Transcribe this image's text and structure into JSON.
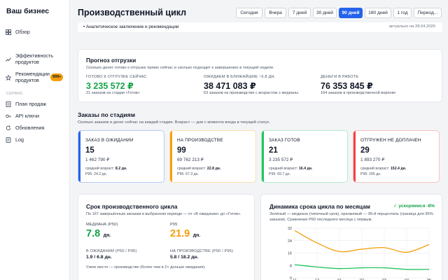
{
  "brand": "Ваш бизнес",
  "nav": [
    {
      "label": "Обзор",
      "icon": "grid-icon"
    },
    {
      "label": "Эффективность продуктов",
      "icon": "trend-icon"
    },
    {
      "label": "Рекомендации продуктов",
      "icon": "star-icon",
      "badge": "999+"
    }
  ],
  "nav_section": "СЕРВИС",
  "nav_service": [
    {
      "label": "План продаж",
      "icon": "document-icon"
    },
    {
      "label": "API ключи",
      "icon": "key-icon"
    },
    {
      "label": "Обновления",
      "icon": "refresh-icon"
    },
    {
      "label": "Log",
      "icon": "log-icon"
    }
  ],
  "header": {
    "title": "Производственный цикл",
    "periods": [
      "Сегодня",
      "Вчера",
      "7 дней",
      "30 дней",
      "90 дней",
      "180 дней",
      "1 год",
      "Период..."
    ],
    "active_period": "90 дней"
  },
  "strip": {
    "left": "•  Аналитическое заключение и рекомендации",
    "right": "актуально на 28.04.2026"
  },
  "forecast": {
    "title": "Прогноз отгрузки",
    "subtitle": "Сколько денег готово к отгрузке прямо сейчас и сколько подходит к завершению в текущей неделе.",
    "metrics": [
      {
        "label": "ГОТОВО К ОТГРУЗКЕ СЕЙЧАС",
        "value": "3 235 572 ₽",
        "note": "21 заказов на стадии «Готов»"
      },
      {
        "label": "ОЖИДАЕМ В БЛИЖАЙШИЕ ~5.8 ДН.",
        "value": "38 471 083 ₽",
        "note": "63 заказов на производстве с возрастом ≥ медианы"
      },
      {
        "label": "ДЕНЬГИ В РАБОТЕ",
        "value": "76 353 845 ₽",
        "note": "164 заказов в производственной воронке"
      }
    ]
  },
  "stages_section": {
    "title": "Заказы по стадиям",
    "subtitle": "Сколько заказов и денег сейчас на каждой стадии. Возраст — дни с момента входа в текущий статус."
  },
  "stages": [
    {
      "label": "ЗАКАЗ В ОЖИДАНИИ",
      "count": "15",
      "money": "1 462 790 ₽",
      "age_label": "средний возраст:",
      "age": "8.2 дн.",
      "p95": "P95: 24.2 дн.",
      "color": "#2563eb"
    },
    {
      "label": "НА ПРОИЗВОДСТВЕ",
      "count": "99",
      "money": "69 762 213 ₽",
      "age_label": "средний возраст:",
      "age": "22.8 дн.",
      "p95": "P95: 67.3 дн.",
      "color": "#f59e0b"
    },
    {
      "label": "ЗАКАЗ ГОТОВ",
      "count": "21",
      "money": "3 235 572 ₽",
      "age_label": "средний возраст:",
      "age": "16.4 дн.",
      "p95": "P95: 69.7 дн.",
      "color": "#22c55e"
    },
    {
      "label": "ОТГРУЖЕН НЕ ДОПЛАЧЕН",
      "count": "29",
      "money": "1 893 270 ₽",
      "age_label": "средний возраст:",
      "age": "152.4 дн.",
      "p95": "P95: 295 дн.",
      "color": "#ef4444"
    }
  ],
  "cycle": {
    "title": "Срок производственного цикла",
    "subtitle": "По 167 завершённым заказам в выбранном периоде — от «В ожидании» до «Готов».",
    "median_label": "МЕДИАНА (P50)",
    "median_value": "7.8",
    "median_unit": "дн.",
    "p95_label": "P95",
    "p95_value": "21.9",
    "p95_unit": "дн.",
    "wait_label": "В ОЖИДАНИИ (P50 / P95)",
    "wait_value": "1.9 / 6.8 дн.",
    "prod_label": "НА ПРОИЗВОДСТВЕ (P50 / P95)",
    "prod_value": "5.8 / 18.2 дн.",
    "note": "Узкое место — производство (более чем в 2× дольше ожидания)."
  },
  "trend": {
    "title": "Динамика срока цикла по месяцам",
    "badge": "✓ ускоряемся -8%",
    "desc": "Зелёный — медиана (типичный срок), оранжевый — 95-й перцентиль (граница для 95% заказов). Сравнение P50 последнего месяца с первым."
  },
  "chart_data": {
    "type": "line",
    "x": [
      "11",
      "12",
      "01",
      "02",
      "03",
      "04",
      "05"
    ],
    "ylim": [
      0,
      32
    ],
    "yticks": [
      0,
      8,
      16,
      24,
      32
    ],
    "grid": true,
    "series": [
      {
        "color": "#f59e0b",
        "values": [
          30.5,
          22.5,
          17,
          18.5,
          19.5,
          16.5,
          21.5
        ]
      },
      {
        "color": "#22c55e",
        "values": [
          8.5,
          7,
          6,
          6.5,
          6.5,
          5.5,
          5.5
        ]
      }
    ]
  },
  "colors": {
    "accent": "#2563eb",
    "positive": "#16a34a",
    "warning": "#f59e0b",
    "danger": "#ef4444",
    "badge": "#f59e0b"
  }
}
